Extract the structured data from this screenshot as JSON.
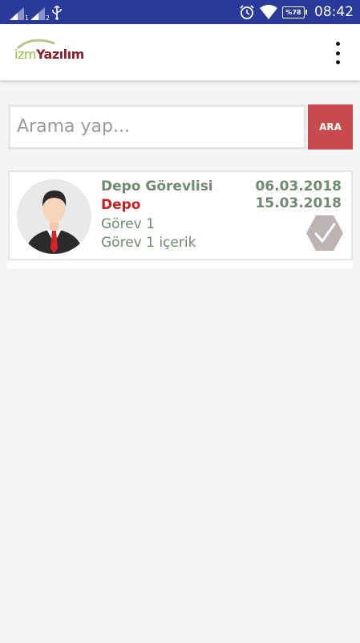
{
  "status_bar": {
    "sim1": "1",
    "sim2": "2",
    "battery": "%78",
    "time": "08:42"
  },
  "app_bar": {
    "logo_left": "izm",
    "logo_right": "Yazılım"
  },
  "search": {
    "placeholder": "Arama yap...",
    "button_label": "ARA"
  },
  "tasks": [
    {
      "title": "Depo Görevlisi",
      "department": "Depo",
      "task_name": "Görev 1",
      "task_description": "Görev 1 içerik",
      "start_date": "06.03.2018",
      "end_date": "15.03.2018"
    }
  ],
  "colors": {
    "status_bar": "#2a3a9a",
    "accent_red": "#c84a4e",
    "text_green": "#6e8a70",
    "department_red": "#c81e1e"
  }
}
